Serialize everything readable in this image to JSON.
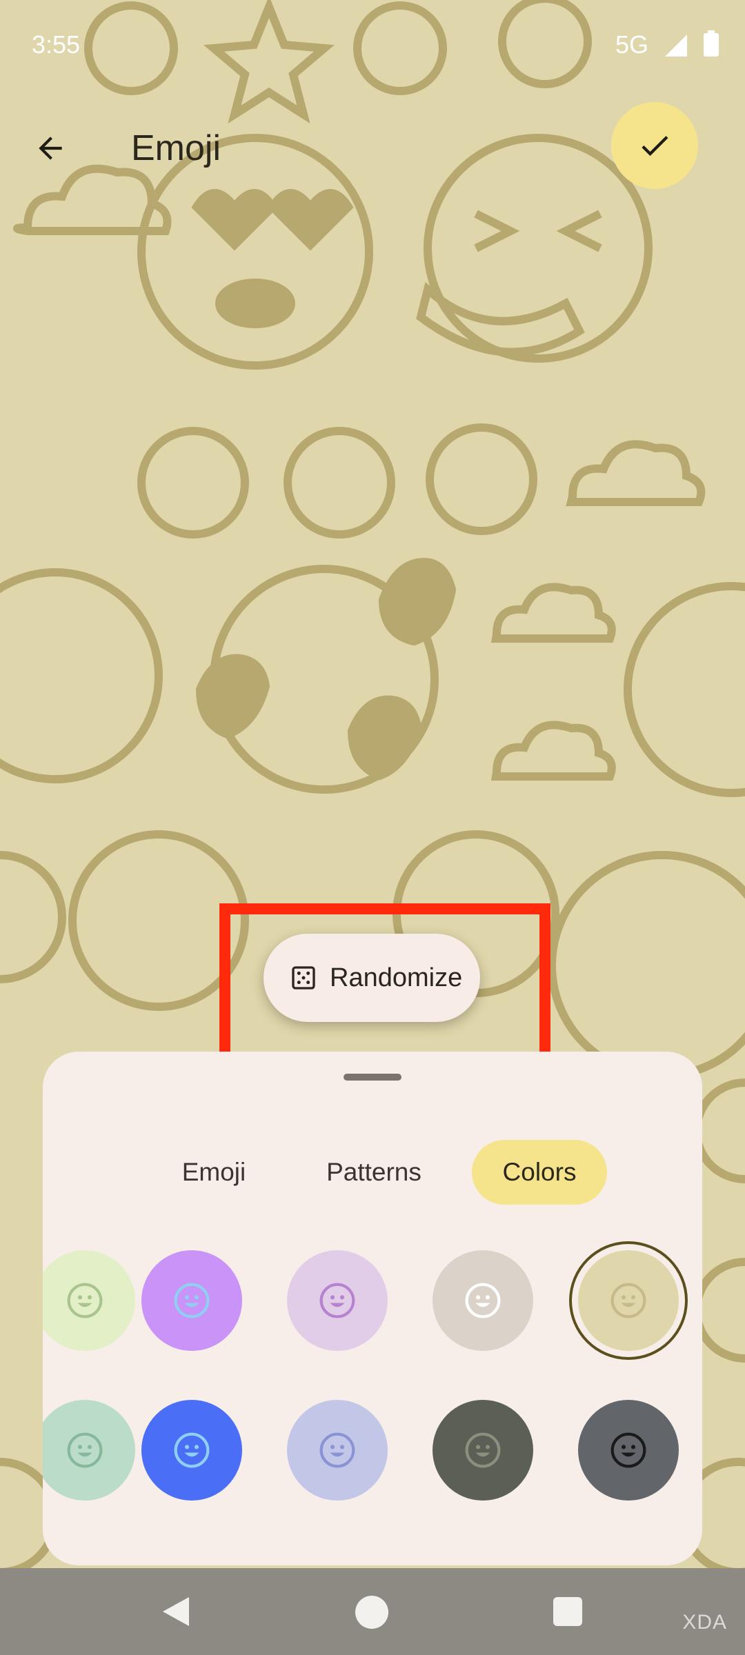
{
  "status_bar": {
    "time": "3:55",
    "network": "5G"
  },
  "top_bar": {
    "title": "Emoji",
    "back_icon": "arrow-left-icon",
    "apply_icon": "check-icon"
  },
  "randomize": {
    "label": "Randomize",
    "icon": "dice-icon"
  },
  "tabs": [
    {
      "label": "Emoji",
      "selected": false
    },
    {
      "label": "Patterns",
      "selected": false
    },
    {
      "label": "Colors",
      "selected": true
    }
  ],
  "swatches": {
    "row1": [
      {
        "color": "#e3f0c7",
        "face": "#a9c48d"
      },
      {
        "color": "#c993f7",
        "face": "#8fd0f2"
      },
      {
        "color": "#e2cde8",
        "face": "#b583cf"
      },
      {
        "color": "#dbd3ca",
        "face": "#ffffff"
      },
      {
        "color": "#e0d6ab",
        "face": "#c6b98a",
        "selected": true
      }
    ],
    "row2": [
      {
        "color": "#bcdcca",
        "face": "#86b89c"
      },
      {
        "color": "#4a6ef5",
        "face": "#8fd0f2"
      },
      {
        "color": "#c2c7e8",
        "face": "#8a93d6"
      },
      {
        "color": "#5b5f55",
        "face": "#8d8f7e"
      },
      {
        "color": "#62666a",
        "face": "#1a1a1a"
      }
    ]
  },
  "navigation": {
    "back": "nav-back-icon",
    "home": "nav-home-icon",
    "recents": "nav-recents-icon"
  },
  "watermark": "XDA",
  "colors": {
    "wallpaper": "#e0d6ab",
    "pattern": "#b6a86e",
    "accent": "#f5e48c",
    "highlight": "#ff2a0b"
  }
}
